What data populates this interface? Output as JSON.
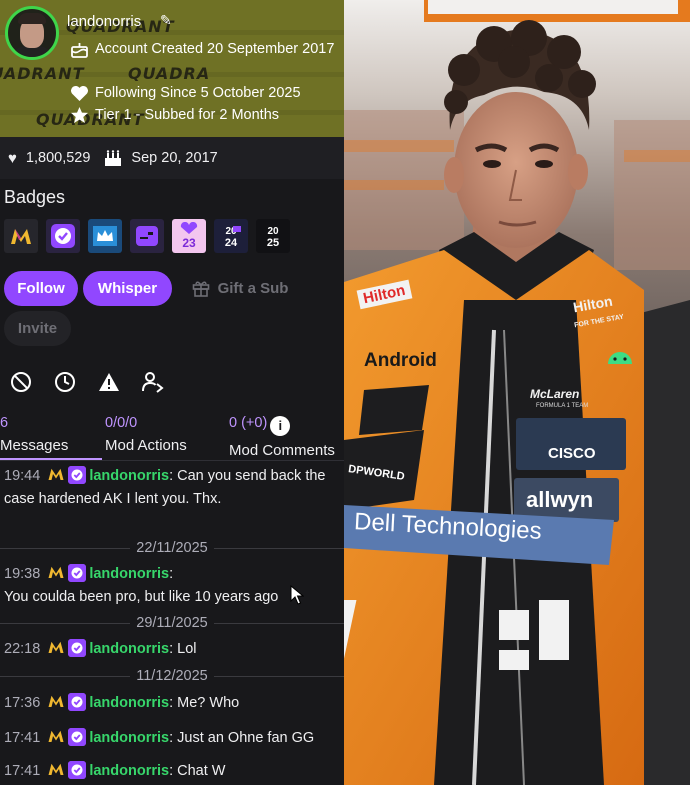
{
  "user": {
    "username": "landonorris",
    "account_created": "Account Created 20 September 2017",
    "following_since": "Following Since 5 October 2025",
    "tier": "Tier 1 - Subbed for 2 Months",
    "follower_count": "1,800,529",
    "creation_date": "Sep 20, 2017"
  },
  "banner_watermark": [
    "QUADRANT",
    "QUADRANT",
    "QUADRA",
    "QUADRANT"
  ],
  "badges": {
    "title": "Badges",
    "items": [
      {
        "icon": "m-logo-icon",
        "text": ""
      },
      {
        "icon": "verified-check-icon",
        "text": ""
      },
      {
        "icon": "crown-icon",
        "text": ""
      },
      {
        "icon": "subscriber-icon",
        "text": ""
      },
      {
        "icon": "year-2023-icon",
        "text": "23"
      },
      {
        "icon": "year-2024-icon",
        "text": "24"
      },
      {
        "icon": "year-2025-icon",
        "text": "25"
      }
    ]
  },
  "actions": {
    "follow": "Follow",
    "whisper": "Whisper",
    "gift_sub": "Gift a Sub",
    "invite": "Invite"
  },
  "mod_tools": [
    "ban-icon",
    "timeout-icon",
    "warn-icon",
    "add-mod-icon"
  ],
  "tabs": [
    {
      "count": "6",
      "label": "Messages"
    },
    {
      "count": "0/0/0",
      "label": "Mod Actions"
    },
    {
      "count": "0 (+0)",
      "label": "Mod Comments"
    }
  ],
  "messages": [
    {
      "time": "19:44",
      "user": "landonorris",
      "text": ": Can you send back the case hardened AK I lent you. Thx."
    },
    {
      "separator": "22/11/2025"
    },
    {
      "time": "19:38",
      "user": "landonorris",
      "text": ":"
    },
    {
      "text_line": "You coulda been pro, but like 10 years ago"
    },
    {
      "separator": "29/11/2025"
    },
    {
      "time": "22:18",
      "user": "landonorris",
      "text": ": Lol"
    },
    {
      "separator": "11/12/2025"
    },
    {
      "time": "17:36",
      "user": "landonorris",
      "text": ": Me? Who"
    },
    {
      "time": "17:41",
      "user": "landonorris",
      "text": ": Just an Ohne fan GG"
    },
    {
      "time": "17:41",
      "user": "landonorris",
      "text": ": Chat W"
    }
  ],
  "photo_text": {
    "hilton": "Hilton",
    "hilton_sub": "FOR THE STAY",
    "android": "Android",
    "mclaren": "McLaren",
    "mclaren_sub": "FORMULA 1 TEAM",
    "cisco": "CISCO",
    "allwyn": "allwyn",
    "dpworld": "DPWORLD",
    "dell_tech": "Dell Technologies"
  },
  "colors": {
    "accent": "#9147ff",
    "username": "#37d66b",
    "banner": "#6f7125",
    "papaya": "#e8811e"
  }
}
